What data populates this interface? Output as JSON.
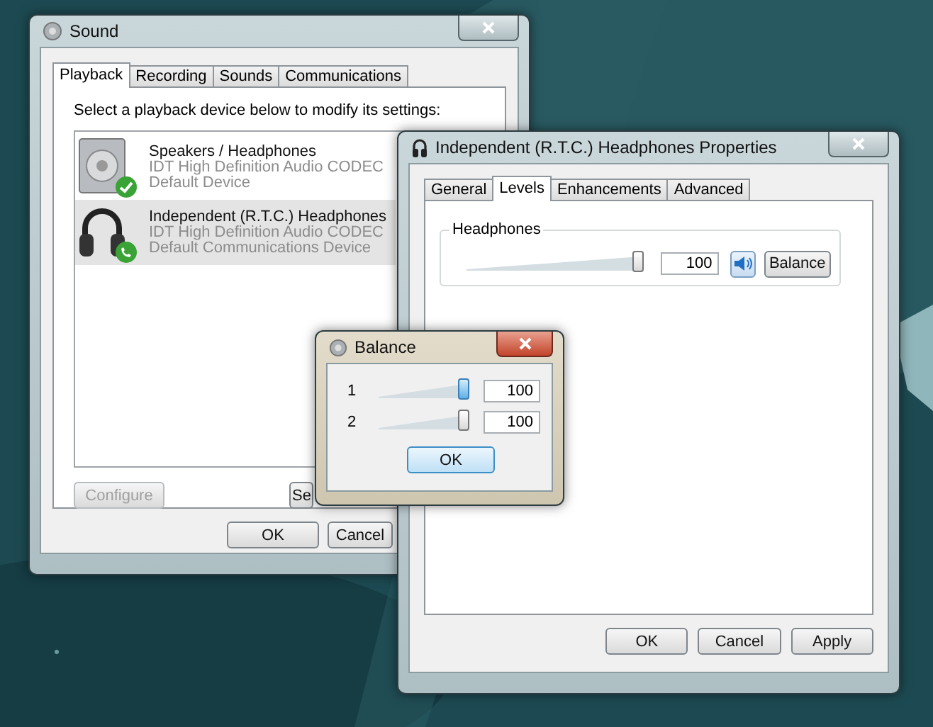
{
  "sound_window": {
    "title": "Sound",
    "active": false,
    "tabs": [
      {
        "label": "Playback",
        "selected": true
      },
      {
        "label": "Recording",
        "selected": false
      },
      {
        "label": "Sounds",
        "selected": false
      },
      {
        "label": "Communications",
        "selected": false
      }
    ],
    "instruction": "Select a playback device below to modify its settings:",
    "devices": [
      {
        "kind": "speaker",
        "default_device": true,
        "default_communications": false,
        "name": "Speakers / Headphones",
        "driver": "IDT High Definition Audio CODEC",
        "status": "Default Device",
        "selected": false
      },
      {
        "kind": "headphones",
        "default_device": false,
        "default_communications": true,
        "name": "Independent (R.T.C.) Headphones",
        "driver": "IDT High Definition Audio CODEC",
        "status": "Default Communications Device",
        "selected": true
      }
    ],
    "configure_button": {
      "label": "Configure",
      "disabled": true
    },
    "set_default_button": {
      "label": "Se",
      "disabled": false
    },
    "buttons": [
      "OK",
      "Cancel"
    ]
  },
  "properties_window": {
    "title": "Independent (R.T.C.) Headphones Properties",
    "active": false,
    "tabs": [
      {
        "label": "General",
        "selected": false
      },
      {
        "label": "Levels",
        "selected": true
      },
      {
        "label": "Enhancements",
        "selected": false
      },
      {
        "label": "Advanced",
        "selected": false
      }
    ],
    "level_group": {
      "label": "Headphones",
      "level": 1,
      "reading": "100",
      "muted": false,
      "balance_button": "Balance"
    },
    "buttons": [
      "OK",
      "Cancel",
      "Apply"
    ]
  },
  "balance_window": {
    "title": "Balance",
    "active": true,
    "channels": [
      {
        "label": "1",
        "level": 1,
        "reading": "100",
        "focused": true
      },
      {
        "label": "2",
        "level": 1,
        "reading": "100",
        "focused": false
      }
    ],
    "ok_button": "OK"
  }
}
